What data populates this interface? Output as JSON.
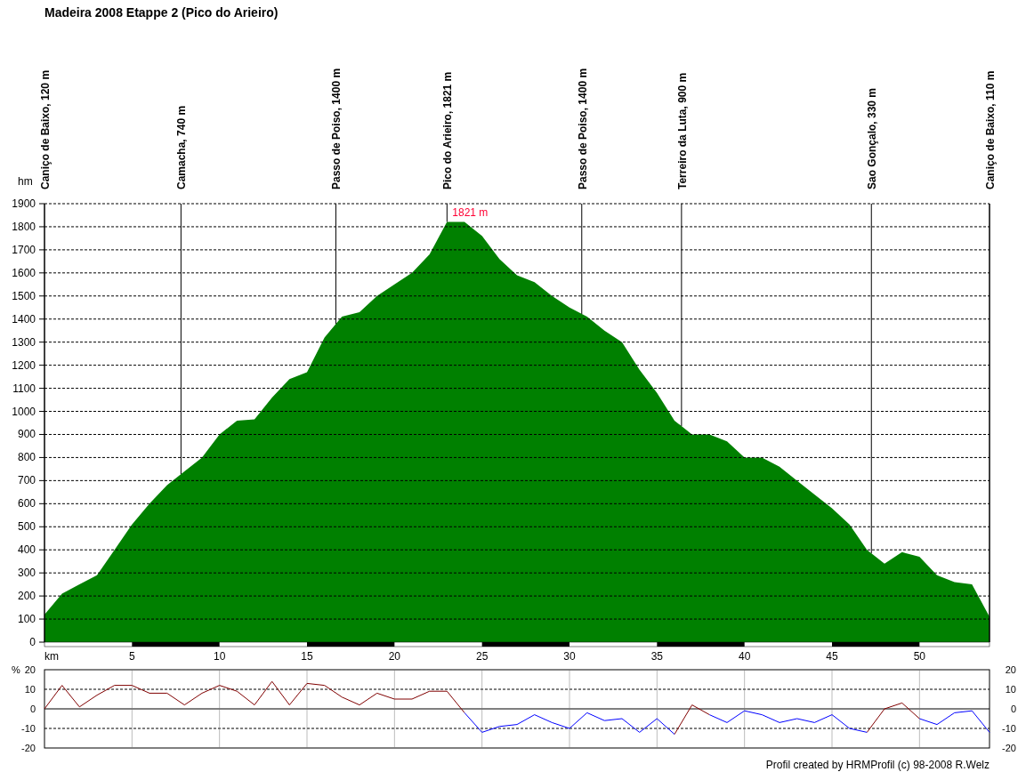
{
  "title": "Madeira 2008 Etappe 2 (Pico do Arieiro)",
  "profile": {
    "chart_data": {
      "type": "area",
      "xlabel": "km",
      "ylabel": "hm",
      "grid": true,
      "x": [
        0,
        1,
        2,
        3,
        4,
        5,
        6,
        7,
        8,
        9,
        10,
        11,
        12,
        13,
        14,
        15,
        16,
        17,
        18,
        19,
        20,
        21,
        22,
        23,
        24,
        25,
        26,
        27,
        28,
        29,
        30,
        31,
        32,
        33,
        34,
        35,
        36,
        37,
        38,
        39,
        40,
        41,
        42,
        43,
        44,
        45,
        46,
        47,
        48,
        49,
        50,
        51,
        52,
        53,
        54
      ],
      "series": [
        {
          "color": "#008000",
          "values": [
            120,
            210,
            250,
            290,
            400,
            510,
            600,
            680,
            740,
            800,
            900,
            960,
            965,
            1060,
            1140,
            1170,
            1320,
            1410,
            1430,
            1500,
            1550,
            1600,
            1680,
            1821,
            1821,
            1760,
            1660,
            1590,
            1560,
            1500,
            1450,
            1410,
            1350,
            1300,
            1180,
            1080,
            960,
            900,
            900,
            870,
            800,
            800,
            760,
            700,
            640,
            580,
            510,
            400,
            340,
            390,
            370,
            290,
            260,
            250,
            110
          ]
        }
      ],
      "xlim": [
        0,
        54
      ],
      "ylim": [
        0,
        1900
      ],
      "xticks": [
        5,
        10,
        15,
        20,
        25,
        30,
        35,
        40,
        45,
        50
      ],
      "yticks": [
        0,
        100,
        200,
        300,
        400,
        500,
        600,
        700,
        800,
        900,
        1000,
        1100,
        1200,
        1300,
        1400,
        1500,
        1600,
        1700,
        1800,
        1900
      ],
      "ref_lines": [
        {
          "axis": "x",
          "value": 0,
          "label": "Caniço de Baixo, 120 m"
        },
        {
          "axis": "x",
          "value": 7.8,
          "label": "Camacha, 740 m"
        },
        {
          "axis": "x",
          "value": 16.65,
          "label": "Passo de Poiso, 1400 m"
        },
        {
          "axis": "x",
          "value": 23,
          "label": "Pico do Arieiro, 1821 m"
        },
        {
          "axis": "x",
          "value": 30.7,
          "label": "Passo de Poiso, 1400 m"
        },
        {
          "axis": "x",
          "value": 36.4,
          "label": "Terreiro da Luta, 900 m"
        },
        {
          "axis": "x",
          "value": 47.25,
          "label": "Sao Gonçalo, 330 m"
        },
        {
          "axis": "x",
          "value": 54,
          "label": "Caniço de Baixo, 110 m"
        }
      ],
      "annotations": [
        {
          "x": 23,
          "y": 1821,
          "text": "1821 m"
        }
      ]
    }
  },
  "gradient": {
    "right_axis_labels": [
      "20",
      "10",
      "0",
      "-10",
      "-20"
    ],
    "chart_data": {
      "type": "line",
      "ylabel": "%",
      "grid": true,
      "x": [
        0,
        1,
        2,
        3,
        4,
        5,
        6,
        7,
        8,
        9,
        10,
        11,
        12,
        13,
        14,
        15,
        16,
        17,
        18,
        19,
        20,
        21,
        22,
        23,
        24,
        25,
        26,
        27,
        28,
        29,
        30,
        31,
        32,
        33,
        34,
        35,
        36,
        37,
        38,
        39,
        40,
        41,
        42,
        43,
        44,
        45,
        46,
        47,
        48,
        49,
        50,
        51,
        52,
        53,
        54
      ],
      "series": [
        {
          "color": "#800000",
          "values": [
            0,
            12,
            1,
            7,
            12,
            12,
            8,
            8,
            2,
            8,
            12,
            9,
            2,
            14,
            2,
            13,
            12,
            6,
            2,
            8,
            5,
            5,
            9,
            9,
            -2,
            null,
            null,
            null,
            null,
            null,
            null,
            null,
            null,
            null,
            null,
            null,
            -13,
            2,
            -3,
            null,
            null,
            null,
            null,
            null,
            null,
            null,
            null,
            -12,
            0,
            3,
            -5,
            null,
            null,
            null,
            null
          ]
        },
        {
          "color": "#0000ff",
          "values": [
            null,
            null,
            null,
            null,
            null,
            null,
            null,
            null,
            null,
            null,
            null,
            null,
            null,
            null,
            null,
            null,
            null,
            null,
            null,
            null,
            null,
            null,
            null,
            null,
            -2,
            -12,
            -9,
            -8,
            -3,
            -7,
            -10,
            -2,
            -6,
            -5,
            -12,
            -5,
            -13,
            null,
            -3,
            -7,
            -1,
            -3,
            -7,
            -5,
            -7,
            -3,
            -10,
            -12,
            null,
            null,
            -5,
            -8,
            -2,
            -1,
            -12
          ]
        }
      ],
      "xlim": [
        0,
        54
      ],
      "ylim": [
        -20,
        20
      ],
      "yticks": [
        -20,
        -10,
        0,
        10,
        20
      ]
    }
  },
  "footer": "Profil created by HRMProfil (c) 98-2008 R.Welz"
}
